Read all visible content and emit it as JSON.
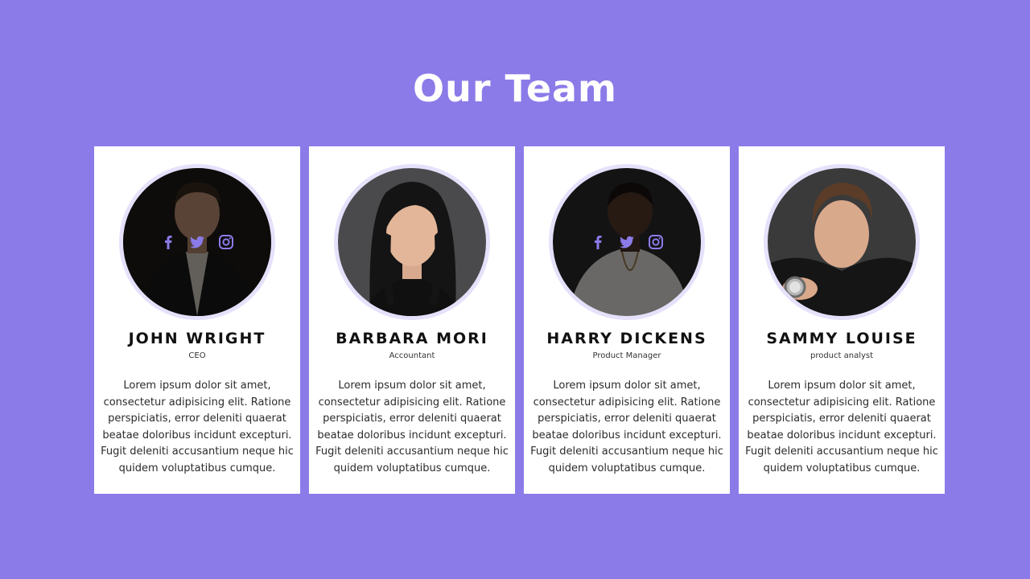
{
  "page": {
    "title": "Our Team"
  },
  "colors": {
    "background": "#8b7be8",
    "card": "#ffffff",
    "accent": "#8b7be8",
    "ring": "#e6e1fb"
  },
  "members": [
    {
      "name": "JOHN WRIGHT",
      "role": "CEO",
      "bio": "Lorem ipsum dolor sit amet, consectetur adipisicing elit. Ratione perspiciatis, error deleniti quaerat beatae doloribus incidunt excepturi. Fugit deleniti accusantium neque hic quidem voluptatibus cumque.",
      "photo": "man-dark-suit-portrait",
      "social_visible": true,
      "social": [
        "facebook-icon",
        "twitter-icon",
        "instagram-icon"
      ]
    },
    {
      "name": "BARBARA MORI",
      "role": "Accountant",
      "bio": "Lorem ipsum dolor sit amet, consectetur adipisicing elit. Ratione perspiciatis, error deleniti quaerat beatae doloribus incidunt excepturi. Fugit deleniti accusantium neque hic quidem voluptatibus cumque.",
      "photo": "woman-long-hair-portrait",
      "social_visible": false,
      "social": [
        "facebook-icon",
        "twitter-icon",
        "instagram-icon"
      ]
    },
    {
      "name": "HARRY DICKENS",
      "role": "Product Manager",
      "bio": "Lorem ipsum dolor sit amet, consectetur adipisicing elit. Ratione perspiciatis, error deleniti quaerat beatae doloribus incidunt excepturi. Fugit deleniti accusantium neque hic quidem voluptatibus cumque.",
      "photo": "man-white-shirt-portrait",
      "social_visible": true,
      "social": [
        "facebook-icon",
        "twitter-icon",
        "instagram-icon"
      ]
    },
    {
      "name": "SAMMY LOUISE",
      "role": "product analyst",
      "bio": "Lorem ipsum dolor sit amet, consectetur adipisicing elit. Ratione perspiciatis, error deleniti quaerat beatae doloribus incidunt excepturi. Fugit deleniti accusantium neque hic quidem voluptatibus cumque.",
      "photo": "young-man-watch-portrait",
      "social_visible": false,
      "social": [
        "facebook-icon",
        "twitter-icon",
        "instagram-icon"
      ]
    }
  ]
}
